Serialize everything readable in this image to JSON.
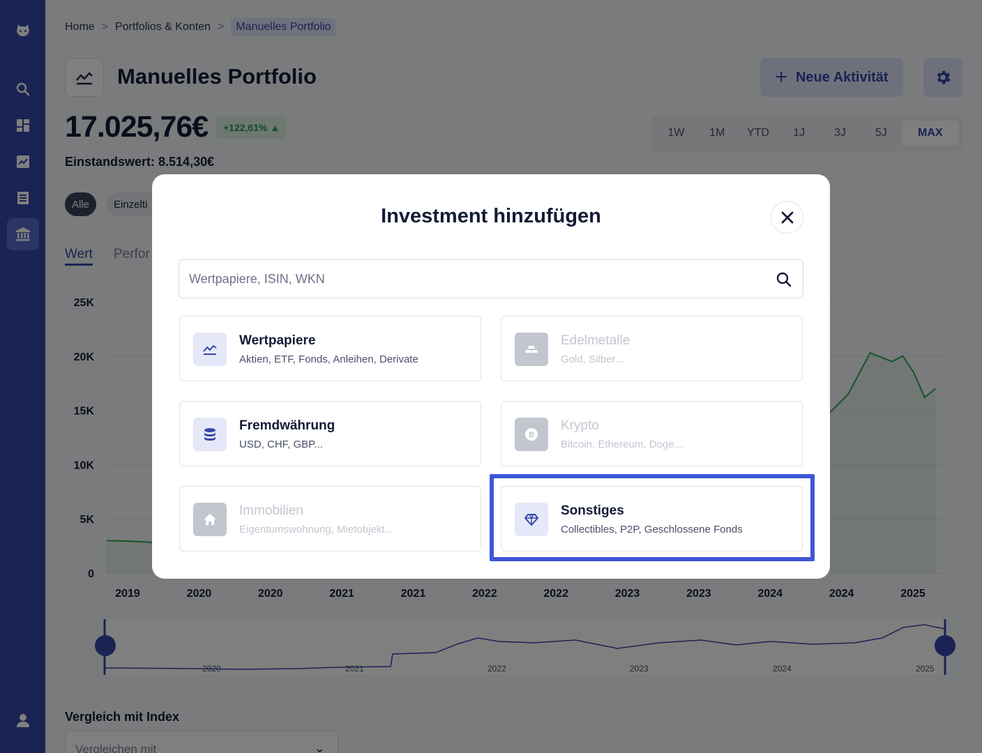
{
  "breadcrumb": {
    "home": "Home",
    "portfolios": "Portfolios & Konten",
    "current": "Manuelles Portfolio",
    "separator": ">"
  },
  "page": {
    "title": "Manuelles Portfolio",
    "value": "17.025,76€",
    "change": "+122,61% ▲",
    "cost_basis": "Einstandswert: 8.514,30€",
    "new_activity_label": "Neue Aktivität",
    "new_activity_icon": "plus-icon",
    "settings_icon": "gear-icon"
  },
  "time_range": {
    "options": [
      "1W",
      "1M",
      "YTD",
      "1J",
      "3J",
      "5J",
      "MAX"
    ],
    "selected": "MAX"
  },
  "filters": {
    "all": "Alle",
    "single": "Einzelti"
  },
  "chart_tabs": {
    "value": "Wert",
    "performance": "Perfor"
  },
  "chart_data": {
    "type": "area",
    "y_ticks": [
      "25K",
      "20K",
      "15K",
      "10K",
      "5K",
      "0"
    ],
    "ylim": [
      0,
      25000
    ],
    "x_ticks": [
      "2019",
      "2020",
      "2020",
      "2021",
      "2021",
      "2022",
      "2022",
      "2023",
      "2023",
      "2024",
      "2024",
      "2025"
    ],
    "series": [
      {
        "values": [
          {
            "x": "2019-01",
            "y": 3000
          },
          {
            "x": "2019-03",
            "y": 2950
          },
          {
            "x": "2019-05",
            "y": 2850
          },
          {
            "x": "2019-06",
            "y": 2300
          },
          {
            "x": "2023-11",
            "y": 11800
          },
          {
            "x": "2024-01",
            "y": 12000
          },
          {
            "x": "2024-02",
            "y": 13400
          },
          {
            "x": "2024-03",
            "y": 11200
          },
          {
            "x": "2024-05",
            "y": 12100
          },
          {
            "x": "2024-07",
            "y": 14500
          },
          {
            "x": "2024-09",
            "y": 16500
          },
          {
            "x": "2024-11",
            "y": 20300
          },
          {
            "x": "2025-01",
            "y": 19500
          },
          {
            "x": "2025-02",
            "y": 20000
          },
          {
            "x": "2025-03",
            "y": 18500
          },
          {
            "x": "2025-04",
            "y": 16200
          },
          {
            "x": "2025-05",
            "y": 17000
          }
        ]
      }
    ],
    "line_color": "#2fa84f",
    "grid": true
  },
  "navigator": {
    "labels": [
      "2020",
      "2021",
      "2022",
      "2023",
      "2024",
      "2025"
    ]
  },
  "compare": {
    "label": "Vergleich mit Index",
    "placeholder": "Vergleichen mit"
  },
  "modal": {
    "title": "Investment hinzufügen",
    "search_placeholder": "Wertpapiere, ISIN, WKN",
    "search_value": "",
    "close_icon": "close-icon",
    "cards": [
      {
        "id": "wertpapiere",
        "title": "Wertpapiere",
        "subtitle": "Aktien, ETF, Fonds, Anleihen, Derivate",
        "icon": "chart-line-icon",
        "enabled": true
      },
      {
        "id": "edelmetalle",
        "title": "Edelmetalle",
        "subtitle": "Gold, Silber...",
        "icon": "gold-bars-icon",
        "enabled": false
      },
      {
        "id": "fremdwaehrung",
        "title": "Fremdwährung",
        "subtitle": "USD, CHF, GBP...",
        "icon": "coins-stack-icon",
        "enabled": true
      },
      {
        "id": "krypto",
        "title": "Krypto",
        "subtitle": "Bitcoin, Ethereum, Doge...",
        "icon": "bitcoin-icon",
        "enabled": false
      },
      {
        "id": "immobilien",
        "title": "Immobilien",
        "subtitle": "Eigentumswohnung, Mietobjekt...",
        "icon": "house-icon",
        "enabled": false
      },
      {
        "id": "sonstiges",
        "title": "Sonstiges",
        "subtitle": "Collectibles, P2P, Geschlossene Fonds",
        "icon": "diamond-icon",
        "enabled": true,
        "highlighted": true
      }
    ]
  },
  "colors": {
    "brand": "#3547a8",
    "accent": "#3e57d8",
    "positive": "#2fa84f"
  }
}
